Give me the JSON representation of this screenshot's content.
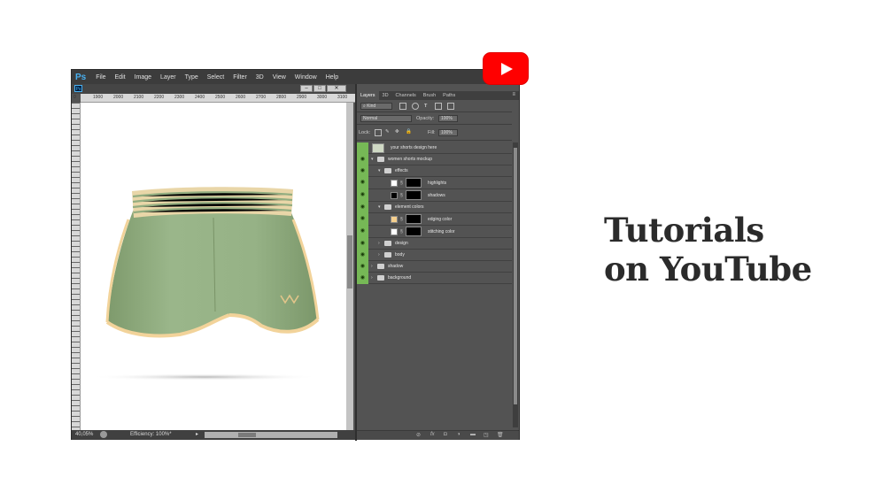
{
  "menubar": {
    "logo": "Ps",
    "items": [
      "File",
      "Edit",
      "Image",
      "Layer",
      "Type",
      "Select",
      "Filter",
      "3D",
      "View",
      "Window",
      "Help"
    ]
  },
  "document": {
    "ps_icon": "Ps",
    "ruler_ticks": [
      "1900",
      "2000",
      "2100",
      "2200",
      "2300",
      "2400",
      "2500",
      "2600",
      "2700",
      "2800",
      "2900",
      "3000",
      "3100"
    ],
    "ruler_origin": "0",
    "window_controls": [
      "minimize",
      "restore",
      "close"
    ]
  },
  "status": {
    "zoom": "40,05%",
    "efficiency": "Efficiency: 100%*"
  },
  "panel": {
    "tabs": [
      "Layers",
      "3D",
      "Channels",
      "Brush",
      "Paths"
    ],
    "filter_kind": "Kind",
    "blend_mode": "Normal",
    "opacity_label": "Opacity:",
    "opacity_value": "100%",
    "lock_label": "Lock:",
    "fill_label": "Fill:",
    "fill_value": "100%"
  },
  "layers": [
    {
      "name": "your shorts design here"
    },
    {
      "name": "women shorts mockup"
    },
    {
      "name": "effects"
    },
    {
      "name": "highlights"
    },
    {
      "name": "shadows"
    },
    {
      "name": "element colors"
    },
    {
      "name": "edging color"
    },
    {
      "name": "stitching color"
    },
    {
      "name": "design"
    },
    {
      "name": "body"
    },
    {
      "name": "shadow"
    },
    {
      "name": "background"
    }
  ],
  "colors": {
    "youtube_red": "#ff0000",
    "eye_green": "#76b856",
    "shorts_green": "#93af82",
    "edging": "#f5cf8e"
  },
  "headline": {
    "line1": "Tutorials",
    "line2": "on YouTube"
  }
}
